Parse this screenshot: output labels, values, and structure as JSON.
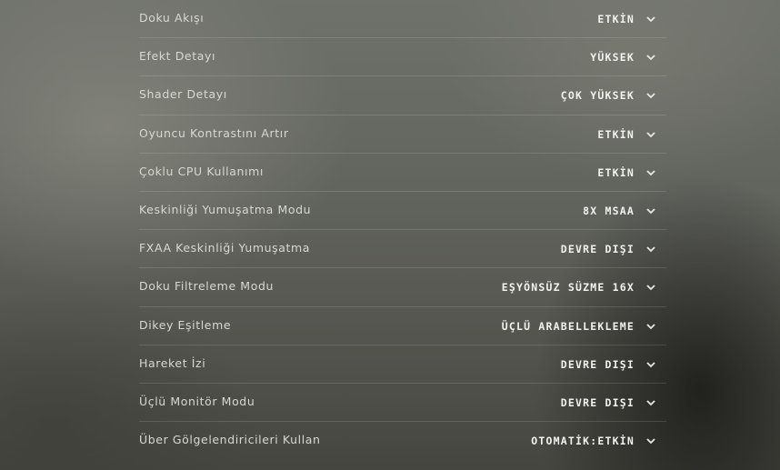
{
  "settings": [
    {
      "label": "Doku Akışı",
      "value": "ETKİN"
    },
    {
      "label": "Efekt Detayı",
      "value": "YÜKSEK"
    },
    {
      "label": "Shader Detayı",
      "value": "ÇOK YÜKSEK"
    },
    {
      "label": "Oyuncu Kontrastını Artır",
      "value": "ETKİN"
    },
    {
      "label": "Çoklu CPU Kullanımı",
      "value": "ETKİN"
    },
    {
      "label": "Keskinliği Yumuşatma Modu",
      "value": "8X MSAA"
    },
    {
      "label": "FXAA Keskinliği Yumuşatma",
      "value": "DEVRE DIŞI"
    },
    {
      "label": "Doku Filtreleme Modu",
      "value": "EŞYÖNSÜZ SÜZME 16X"
    },
    {
      "label": "Dikey Eşitleme",
      "value": "ÜÇLÜ ARABELLEKLEME"
    },
    {
      "label": "Hareket İzi",
      "value": "DEVRE DIŞI"
    },
    {
      "label": "Üçlü Monitör Modu",
      "value": "DEVRE DIŞI"
    },
    {
      "label": "Über Gölgelendiricileri Kullan",
      "value": "OTOMATİK:ETKİN"
    }
  ],
  "icons": {
    "dropdown": "chevron-down-icon"
  }
}
